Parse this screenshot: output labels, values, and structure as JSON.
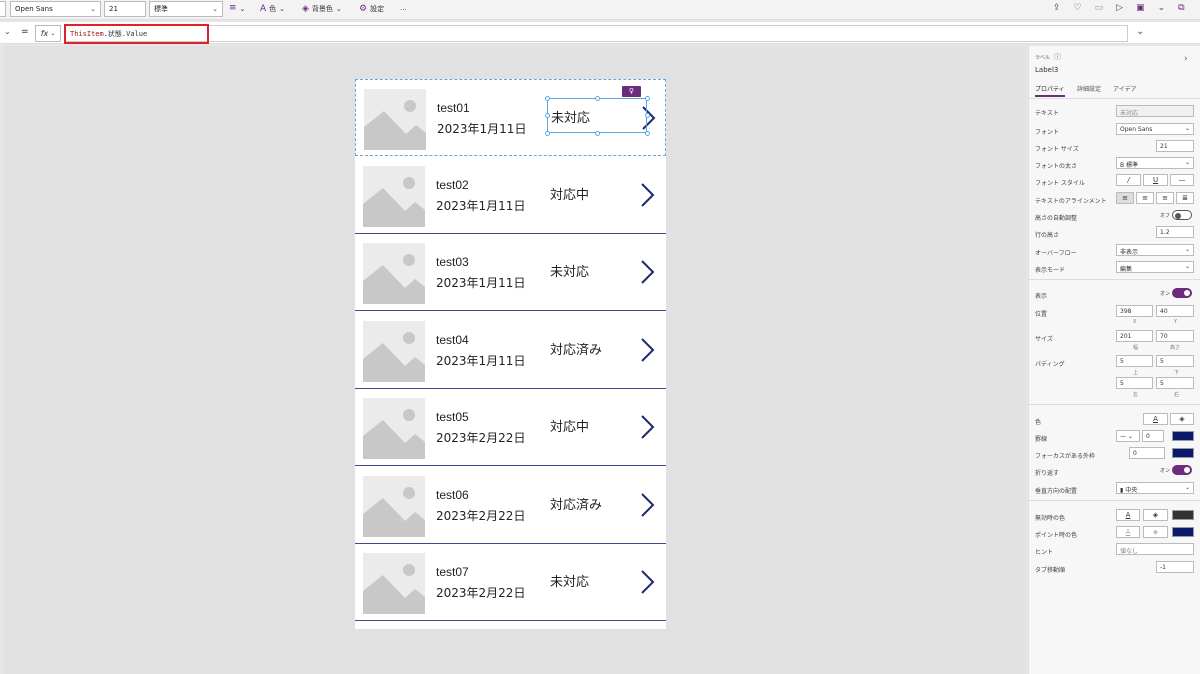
{
  "ribbon": {
    "font": "Open Sans",
    "size": "21",
    "weight": "標準",
    "color_label": "色",
    "bg_label": "背景色",
    "settings_label": "設定",
    "more": "..."
  },
  "formula": {
    "equals": "=",
    "fx": "fx",
    "keyword": "ThisItem",
    "rest": ".状態.Value"
  },
  "gallery": [
    {
      "title": "test01",
      "date": "2023年1月11日",
      "status": "未対応"
    },
    {
      "title": "test02",
      "date": "2023年1月11日",
      "status": "対応中"
    },
    {
      "title": "test03",
      "date": "2023年1月11日",
      "status": "未対応"
    },
    {
      "title": "test04",
      "date": "2023年1月11日",
      "status": "対応済み"
    },
    {
      "title": "test05",
      "date": "2023年2月22日",
      "status": "対応中"
    },
    {
      "title": "test06",
      "date": "2023年2月22日",
      "status": "対応済み"
    },
    {
      "title": "test07",
      "date": "2023年2月22日",
      "status": "未対応"
    }
  ],
  "panel": {
    "type": "ラベル",
    "name": "Label3",
    "tabs": [
      "プロパティ",
      "詳細設定",
      "アイデア"
    ],
    "rows": {
      "text": {
        "label": "テキスト",
        "value": "未対応"
      },
      "font": {
        "label": "フォント",
        "value": "Open Sans"
      },
      "font_size": {
        "label": "フォント サイズ",
        "value": "21"
      },
      "font_weight": {
        "label": "フォントの太さ",
        "value": "B 標準"
      },
      "font_style": {
        "label": "フォント スタイル"
      },
      "text_align": {
        "label": "テキストのアラインメント"
      },
      "auto_height": {
        "label": "高さの自動調整",
        "toggle_text": "オフ"
      },
      "line_height": {
        "label": "行の高さ",
        "value": "1.2"
      },
      "overflow": {
        "label": "オーバーフロー",
        "value": "非表示"
      },
      "display_mode": {
        "label": "表示モード",
        "value": "編集"
      },
      "visible": {
        "label": "表示",
        "toggle_text": "オン"
      },
      "position": {
        "label": "位置",
        "x": "398",
        "y": "40",
        "x_label": "X",
        "y_label": "Y"
      },
      "size": {
        "label": "サイズ",
        "w": "201",
        "h": "70",
        "w_label": "幅",
        "h_label": "高さ"
      },
      "padding": {
        "label": "パディング",
        "top": "5",
        "bottom": "5",
        "left": "5",
        "right": "5",
        "top_label": "上",
        "bottom_label": "下",
        "left_label": "左",
        "right_label": "右"
      },
      "color": {
        "label": "色"
      },
      "border": {
        "label": "罫線",
        "value": "0"
      },
      "focus_border": {
        "label": "フォーカスがある外枠",
        "value": "0"
      },
      "wrap": {
        "label": "折り返す",
        "toggle_text": "オン"
      },
      "vertical_align": {
        "label": "垂直方向の配置",
        "value": "中央"
      },
      "disabled_color": {
        "label": "無効時の色"
      },
      "hover_color": {
        "label": "ポイント時の色"
      },
      "tooltip": {
        "label": "ヒント",
        "value": "値なし"
      },
      "tab_index": {
        "label": "タブ移動順",
        "value": "-1"
      }
    }
  },
  "colors": {
    "accent": "#6b2d7b",
    "navy": "#0b1a6e",
    "divider": "#3c4a8c",
    "highlight": "#e0202a"
  }
}
